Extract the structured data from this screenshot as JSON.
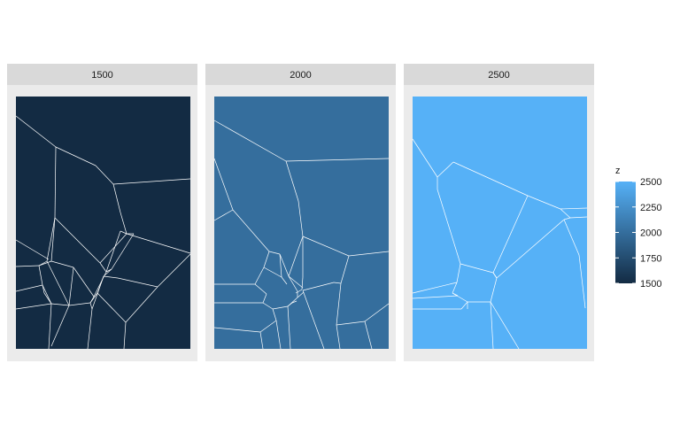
{
  "chart_data": {
    "type": "heatmap",
    "facet_labels": [
      "1500",
      "2000",
      "2500"
    ],
    "facet_fill_values": [
      1500,
      2000,
      2500
    ],
    "legend": {
      "title": "z",
      "range": [
        1500,
        2500
      ],
      "ticks": [
        "2500",
        "2250",
        "2000",
        "1750",
        "1500"
      ],
      "tick_values": [
        2500,
        2250,
        2000,
        1750,
        1500
      ],
      "low_color": "#132b43",
      "high_color": "#56b1f7",
      "placement": "right"
    },
    "panel_background": "#ebebeb",
    "strip_background": "#d9d9d9",
    "edge_color": "#ffffff"
  }
}
